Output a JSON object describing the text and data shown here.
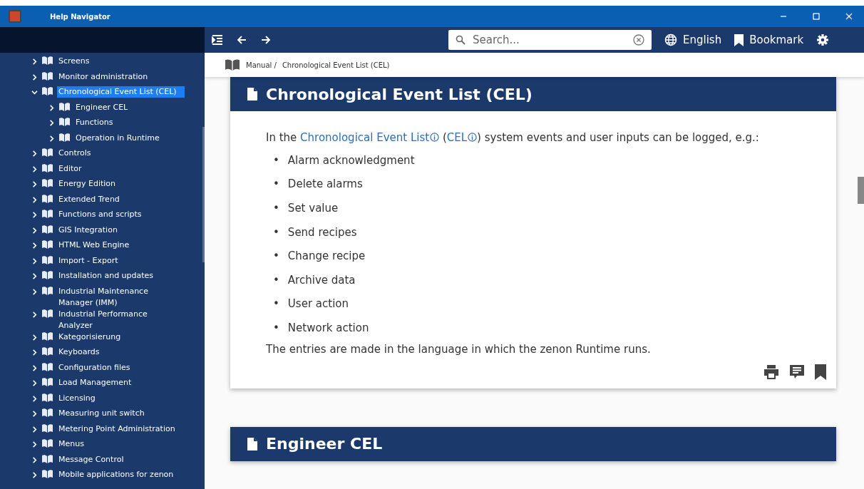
{
  "window": {
    "title": "Help Navigator"
  },
  "tree": [
    {
      "label": "Screens",
      "expanded": false,
      "selected": false
    },
    {
      "label": "Monitor administration",
      "expanded": false,
      "selected": false
    },
    {
      "label": "Chronological Event List (CEL)",
      "expanded": true,
      "selected": true,
      "children": [
        {
          "label": "Engineer CEL",
          "expanded": false,
          "selected": false
        },
        {
          "label": "Functions",
          "expanded": false,
          "selected": false
        },
        {
          "label": "Operation in Runtime",
          "expanded": false,
          "selected": false
        }
      ]
    },
    {
      "label": "Controls",
      "expanded": false,
      "selected": false
    },
    {
      "label": "Editor",
      "expanded": false,
      "selected": false
    },
    {
      "label": "Energy Edition",
      "expanded": false,
      "selected": false
    },
    {
      "label": "Extended Trend",
      "expanded": false,
      "selected": false
    },
    {
      "label": "Functions and scripts",
      "expanded": false,
      "selected": false
    },
    {
      "label": "GIS Integration",
      "expanded": false,
      "selected": false
    },
    {
      "label": "HTML Web Engine",
      "expanded": false,
      "selected": false
    },
    {
      "label": "Import - Export",
      "expanded": false,
      "selected": false
    },
    {
      "label": "Installation and updates",
      "expanded": false,
      "selected": false
    },
    {
      "label": "Industrial Maintenance Manager (IMM)",
      "expanded": false,
      "selected": false
    },
    {
      "label": "Industrial Performance Analyzer",
      "expanded": false,
      "selected": false
    },
    {
      "label": "Kategorisierung",
      "expanded": false,
      "selected": false
    },
    {
      "label": "Keyboards",
      "expanded": false,
      "selected": false
    },
    {
      "label": "Configuration files",
      "expanded": false,
      "selected": false
    },
    {
      "label": "Load Management",
      "expanded": false,
      "selected": false
    },
    {
      "label": "Licensing",
      "expanded": false,
      "selected": false
    },
    {
      "label": "Measuring unit switch",
      "expanded": false,
      "selected": false
    },
    {
      "label": "Metering Point Administration",
      "expanded": false,
      "selected": false
    },
    {
      "label": "Menus",
      "expanded": false,
      "selected": false
    },
    {
      "label": "Message Control",
      "expanded": false,
      "selected": false
    },
    {
      "label": "Mobile applications for zenon",
      "expanded": false,
      "selected": false
    }
  ],
  "toolbar": {
    "search": {
      "placeholder": "Search..."
    },
    "language": "English",
    "bookmark": "Bookmark"
  },
  "breadcrumb": [
    "Manual /",
    "Chronological Event List (CEL)"
  ],
  "sections": [
    {
      "title": "Chronological Event List (CEL)",
      "intro": [
        {
          "kind": "text",
          "text": "In the "
        },
        {
          "kind": "link",
          "text": "Chronological Event List",
          "info": true
        },
        {
          "kind": "text",
          "text": " ("
        },
        {
          "kind": "link",
          "text": "CEL",
          "info": true
        },
        {
          "kind": "text",
          "text": ") system events and user inputs can be logged, e.g.:"
        }
      ],
      "bullets": [
        {
          "marker": "•",
          "text": "Alarm acknowledgment"
        },
        {
          "marker": "•",
          "text": "Delete alarms"
        },
        {
          "marker": "•",
          "text": "Set value"
        },
        {
          "marker": "•",
          "text": "Send recipes"
        },
        {
          "marker": "•",
          "text": "Change recipe"
        },
        {
          "marker": "•",
          "text": "Archive data"
        },
        {
          "marker": "•",
          "text": "User action"
        },
        {
          "marker": "•",
          "text": "Network action"
        }
      ],
      "note": "The entries are made in the language in which the zenon Runtime runs."
    },
    {
      "title": "Engineer CEL"
    }
  ]
}
